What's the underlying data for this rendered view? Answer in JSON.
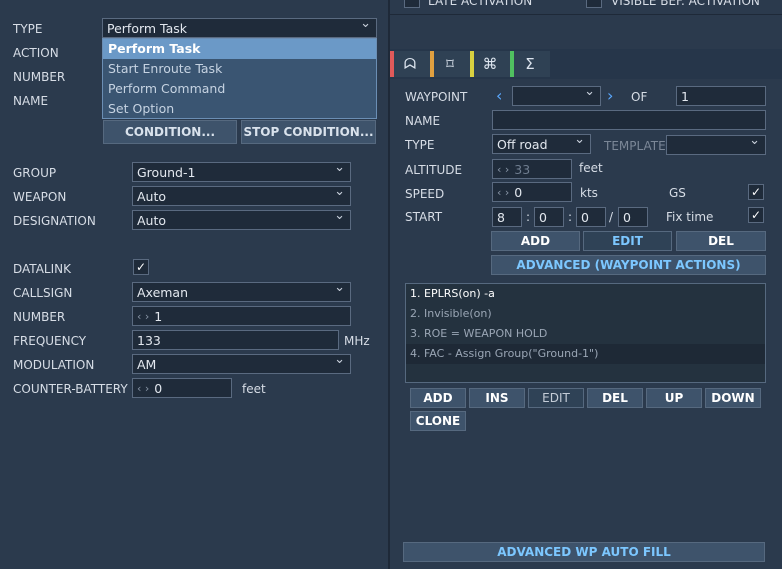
{
  "top": {
    "late_activation": "LATE ACTIVATION",
    "visible_activation": "VISIBLE BEF. ACTIVATION"
  },
  "left": {
    "type_label": "TYPE",
    "type_value": "Perform Task",
    "action_label": "ACTION",
    "number_label": "NUMBER",
    "name_label": "NAME",
    "dropdown_options": [
      "Perform Task",
      "Start Enroute Task",
      "Perform Command",
      "Set Option"
    ],
    "condition_btn": "CONDITION...",
    "stop_condition_btn": "STOP CONDITION...",
    "group_label": "GROUP",
    "group_value": "Ground-1",
    "weapon_label": "WEAPON",
    "weapon_value": "Auto",
    "designation_label": "DESIGNATION",
    "designation_value": "Auto",
    "datalink_label": "DATALINK",
    "callsign_label": "CALLSIGN",
    "callsign_value": "Axeman",
    "number2_label": "NUMBER",
    "number2_value": "1",
    "frequency_label": "FREQUENCY",
    "frequency_value": "133",
    "frequency_unit": "MHz",
    "modulation_label": "MODULATION",
    "modulation_value": "AM",
    "counter_label": "COUNTER-BATTERY",
    "counter_value": "0",
    "counter_unit": "feet"
  },
  "right": {
    "tab_icons": [
      "route-icon",
      "target-icon",
      "command-icon",
      "sigma-icon"
    ],
    "tab_colors": [
      "#e05a5a",
      "#e0a040",
      "#d8d040",
      "#50c060"
    ],
    "waypoint_label": "WAYPOINT",
    "of_label": "OF",
    "of_value": "1",
    "name_label": "NAME",
    "type_label": "TYPE",
    "type_value": "Off road",
    "template_label": "TEMPLATE",
    "altitude_label": "ALTITUDE",
    "altitude_value": "33",
    "altitude_unit": "feet",
    "speed_label": "SPEED",
    "speed_value": "0",
    "speed_unit": "kts",
    "gs_label": "GS",
    "start_label": "START",
    "start_h": "8",
    "start_m": "0",
    "start_s": "0",
    "start_f": "0",
    "sep1": ":",
    "sep2": ":",
    "sep3": "/",
    "fix_time_label": "Fix time",
    "add_btn": "ADD",
    "edit_btn": "EDIT",
    "del_btn": "DEL",
    "advanced_btn": "ADVANCED (WAYPOINT ACTIONS)",
    "actions": [
      "1. EPLRS(on)  -a",
      "2. Invisible(on)",
      "3. ROE = WEAPON HOLD",
      "4. FAC - Assign Group(\"Ground-1\")"
    ],
    "list_buttons": {
      "add": "ADD",
      "ins": "INS",
      "edit": "EDIT",
      "del": "DEL",
      "up": "UP",
      "down": "DOWN",
      "clone": "CLONE"
    },
    "auto_fill_btn": "ADVANCED WP AUTO FILL"
  }
}
